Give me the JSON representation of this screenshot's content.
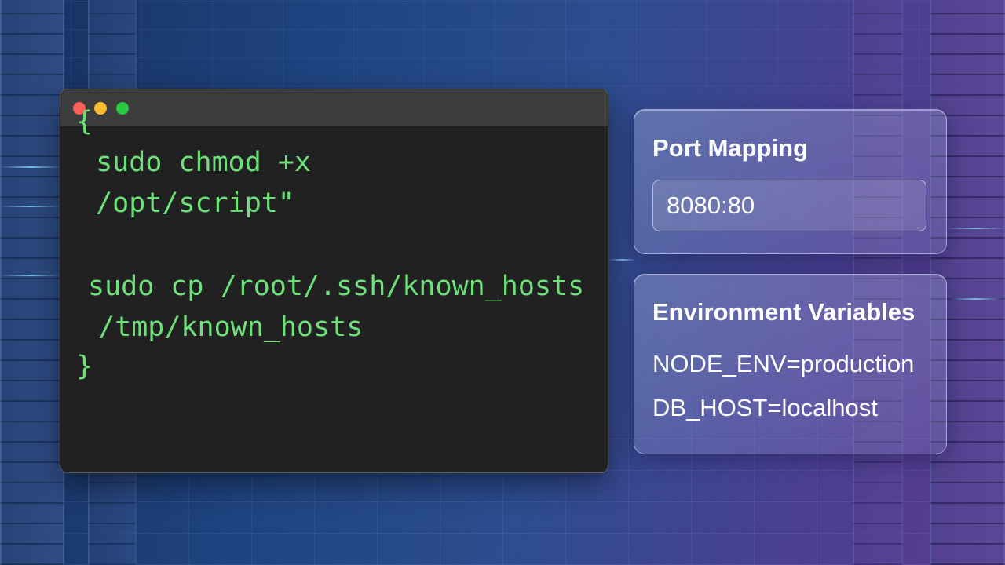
{
  "colors": {
    "code_text": "#6ee07a",
    "window_bg": "#212121",
    "titlebar_bg": "#3d3d3d",
    "close_dot": "#ff5f57",
    "minimize_dot": "#febc2e",
    "maximize_dot": "#28c840"
  },
  "terminal": {
    "window_controls": [
      "close-dot",
      "minimize-dot",
      "maximize-dot"
    ],
    "lines": [
      "{",
      " sudo chmod +x",
      " /opt/script\"",
      "",
      "sudo cp /root/.ssh/known_hosts",
      " /tmp/known_hosts",
      "}"
    ]
  },
  "port_mapping": {
    "title": "Port Mapping",
    "value": "8080:80"
  },
  "env_vars": {
    "title": "Environment Variables",
    "items": [
      "NODE_ENV=production",
      "DB_HOST=localhost"
    ]
  }
}
